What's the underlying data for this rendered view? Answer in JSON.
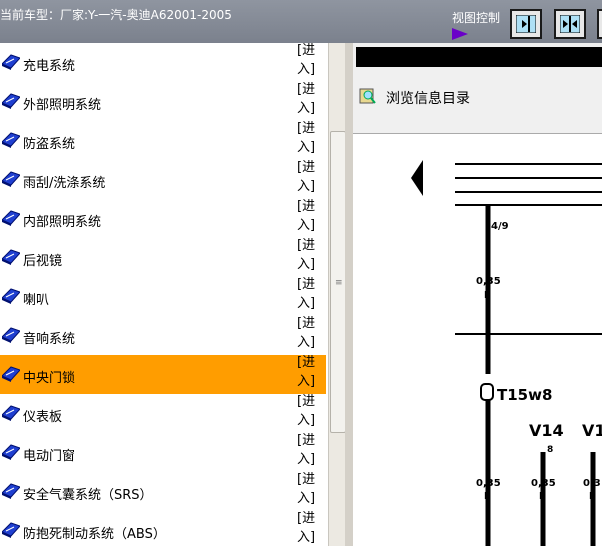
{
  "header": {
    "car_model": "当前车型：厂家:Y-一汽-奥迪A62001-2005",
    "view_control_label": "视图控制"
  },
  "list": {
    "items": [
      {
        "label": "充电系统",
        "enter": "[进入]",
        "selected": false
      },
      {
        "label": "外部照明系统",
        "enter": "[进入]",
        "selected": false
      },
      {
        "label": "防盗系统",
        "enter": "[进入]",
        "selected": false
      },
      {
        "label": "雨刮/洗涤系统",
        "enter": "[进入]",
        "selected": false
      },
      {
        "label": "内部照明系统",
        "enter": "[进入]",
        "selected": false
      },
      {
        "label": "后视镜",
        "enter": "[进入]",
        "selected": false
      },
      {
        "label": "喇叭",
        "enter": "[进入]",
        "selected": false
      },
      {
        "label": "音响系统",
        "enter": "[进入]",
        "selected": false
      },
      {
        "label": "中央门锁",
        "enter": "[进入]",
        "selected": true
      },
      {
        "label": "仪表板",
        "enter": "[进入]",
        "selected": false
      },
      {
        "label": "电动门窗",
        "enter": "[进入]",
        "selected": false
      },
      {
        "label": "安全气囊系统（SRS）",
        "enter": "[进入]",
        "selected": false
      },
      {
        "label": "防抱死制动系统（ABS）",
        "enter": "[进入]",
        "selected": false
      }
    ]
  },
  "viewer": {
    "browse_label": "浏览信息目录",
    "diagram": {
      "wire_top": "4/9",
      "wire_main": "0,35",
      "wire_main_color": "ll",
      "connector": "T15w8",
      "comp1": "V14",
      "comp1_pin": "8",
      "comp2": "V1",
      "wire2": "0,35",
      "wire2_color": "ll",
      "wire3": "0,35",
      "wire3_color": "ll",
      "wire4": "0,3",
      "wire4_color": "ll"
    }
  },
  "colors": {
    "selected_row": "#ff9d00",
    "header_bg": "#7b818d",
    "view_arrow": "#6a00c8",
    "view_button": "#aee0f5"
  }
}
